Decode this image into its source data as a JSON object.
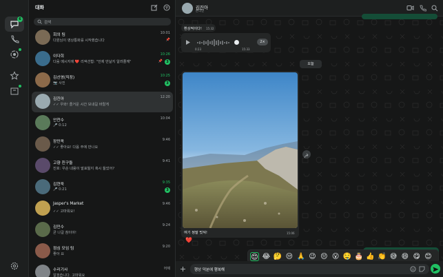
{
  "sidebar": {
    "title": "대화",
    "search_placeholder": "검색"
  },
  "chats": [
    {
      "name": "회의 팀",
      "preview": "다원님이 영상통화를 시작했습니다",
      "time": "10:01",
      "time_green": false,
      "badge": "",
      "pinned": true,
      "avatar_color": "#7a6a55"
    },
    {
      "name": "이다희",
      "preview": "다음 메시지에 ❤️ 리액션함: \"언제 만날지 알려줄께\"",
      "time": "10:26",
      "time_green": true,
      "badge": "3",
      "pinned": true,
      "avatar_color": "#3a6c8c"
    },
    {
      "name": "김선영(직장)",
      "preview": "📷 사진",
      "time": "10:25",
      "time_green": true,
      "badge": "3",
      "pinned": false,
      "avatar_color": "#8c6a4a"
    },
    {
      "name": "김진아",
      "preview": "✓✓ 우와! 즐거운 시간 보내길 바랄게",
      "time": "12:20",
      "time_green": false,
      "badge": "",
      "pinned": false,
      "avatar_color": "#9aaab0"
    },
    {
      "name": "안찬수",
      "preview": "🎤 0:12",
      "time": "10:04",
      "time_green": false,
      "badge": "",
      "pinned": false,
      "avatar_color": "#5a7a5a"
    },
    {
      "name": "장민옥",
      "preview": "✓✓ 좋아요! 다음 주에 만나요",
      "time": "9:46",
      "time_green": false,
      "badge": "",
      "pinned": false,
      "avatar_color": "#6a5a4a"
    },
    {
      "name": "고향 친구들",
      "preview": "진호: 우순 내용이 발표될지 혹시 들었어?",
      "time": "9:41",
      "time_green": false,
      "badge": "",
      "pinned": false,
      "avatar_color": "#5a4a6a"
    },
    {
      "name": "김현욱",
      "preview": "🎤 0:21",
      "time": "9:35",
      "time_green": true,
      "badge": "3",
      "pinned": false,
      "avatar_color": "#4a6a7a"
    },
    {
      "name": "Jasper's Market",
      "preview": "✓✓ 고마워요!",
      "time": "9:46",
      "time_green": false,
      "badge": "",
      "pinned": false,
      "avatar_color": "#c0a050"
    },
    {
      "name": "김민수",
      "preview": "곧 나갈 참이야!",
      "time": "9:24",
      "time_green": false,
      "badge": "",
      "pinned": false,
      "avatar_color": "#5a6a4a"
    },
    {
      "name": "점심 모임 팀",
      "preview": "좋아 요",
      "time": "9:20",
      "time_green": false,
      "badge": "",
      "pinned": false,
      "avatar_color": "#8a5a4a"
    },
    {
      "name": "수리기사",
      "preview": "알겠습니다. 고마워요",
      "time": "어제",
      "time_green": false,
      "badge": "",
      "pinned": false,
      "avatar_color": "#808488"
    }
  ],
  "conversation": {
    "name": "김진아",
    "status": "온라인",
    "msg_welcome": "환상적이다!",
    "msg_welcome_time": "15:32",
    "voice_start": "0:23",
    "voice_time": "15:33",
    "speed": "2×",
    "date_chip": "오늘",
    "photo_caption": "여기 정말 멋져!",
    "photo_time": "15:06",
    "reaction": "❤️",
    "composer_text": "행상 덕분에 행복해"
  },
  "emojis": [
    "😊",
    "😂",
    "🤔",
    "😒",
    "🙏",
    "😉",
    "😔",
    "😮",
    "🤤",
    "🎂",
    "👍",
    "👏",
    "😅",
    "😄",
    "😋",
    "😊"
  ],
  "colors": {
    "accent": "#21c063",
    "bg": "#161717",
    "panel": "#1d1f1f"
  }
}
